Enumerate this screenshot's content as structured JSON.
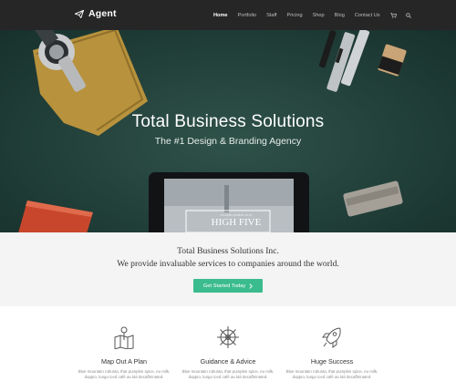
{
  "brand": {
    "name": "Agent",
    "logo_icon": "paper-plane-icon"
  },
  "nav": {
    "items": [
      {
        "label": "Home",
        "active": true
      },
      {
        "label": "Portfolio",
        "active": false
      },
      {
        "label": "Staff",
        "active": false
      },
      {
        "label": "Pricing",
        "active": false
      },
      {
        "label": "Shop",
        "active": false
      },
      {
        "label": "Blog",
        "active": false
      },
      {
        "label": "Contact Us",
        "active": false
      }
    ],
    "cart_icon": "cart-icon",
    "search_icon": "search-icon"
  },
  "hero": {
    "title": "Total Business Solutions",
    "subtitle": "The #1 Design & Branding Agency",
    "tablet_text": "HIGH FIVE",
    "tablet_small": "ESTABLISHED 2010"
  },
  "intro": {
    "line1": "Total Business Solutions Inc.",
    "line2": "We provide invaluable services to companies around the world.",
    "cta_label": "Get Started Today",
    "cta_icon": "chevron-right-icon"
  },
  "features": [
    {
      "icon": "map-pin-icon",
      "title": "Map Out A Plan",
      "text": "Blue mountain robusta, that pumpkin spice, eu milk, doppio, lungo iced café au lait decaffeinated."
    },
    {
      "icon": "ship-wheel-icon",
      "title": "Guidance & Advice",
      "text": "Blue mountain robusta, that pumpkin spice, eu milk, doppio, lungo iced café au lait decaffeinated."
    },
    {
      "icon": "rocket-icon",
      "title": "Huge Success",
      "text": "Blue mountain robusta, that pumpkin spice, eu milk, doppio, lungo iced café au lait decaffeinated."
    }
  ],
  "colors": {
    "nav_bg": "#262626",
    "hero_bg": "#22403a",
    "accent": "#3bbc8f",
    "intro_bg": "#f4f4f4"
  }
}
